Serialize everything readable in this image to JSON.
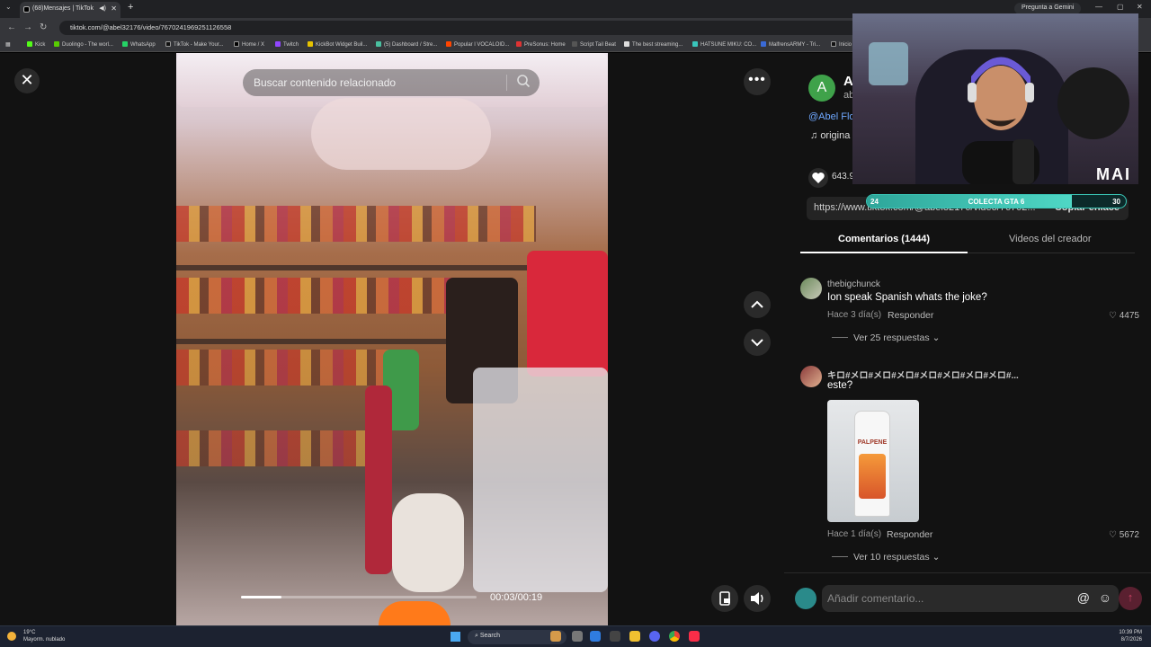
{
  "browser": {
    "tab_title": "(68)Mensajes | TikTok",
    "tab_close": "✕",
    "new_tab": "+",
    "gemini_label": "Pregunta a Gemini",
    "url": "tiktok.com/@abel32176/video/7670241969251126558",
    "bookmarks": [
      "Kick",
      "Duolingo - The worl...",
      "WhatsApp",
      "TikTok - Make Your...",
      "Home / X",
      "Twitch",
      "KickBot Widget Buil...",
      "(5) Dashboard / Stre...",
      "Popular l VOCALOID...",
      "PreSonus: Home",
      "Script Tail Beat",
      "The best streaming...",
      "HATSUNE MIKU: CO...",
      "MalfrensARMY - Tri...",
      "Inicio"
    ]
  },
  "video": {
    "search_placeholder": "Buscar contenido relacionado",
    "time": "00:03/00:19",
    "progress": 0.17
  },
  "creator": {
    "avatar_letter": "A",
    "name": "A",
    "username": "ab",
    "handle": "@Abel Flo",
    "music": "origina",
    "likes": "643.9",
    "link": "https://www.tiktok.com/@abel32176/video/76702...",
    "copy_label": "Copiar enlace"
  },
  "tabs": {
    "comments": "Comentarios (1444)",
    "creator_videos": "Videos del creador"
  },
  "comments": [
    {
      "user": "thebigchunck",
      "text": "Ion speak Spanish whats the joke?",
      "time": "Hace 3 día(s)",
      "reply": "Responder",
      "likes": "4475",
      "views": "Ver 25 respuestas"
    },
    {
      "user": "キロ#メロ#メロ#メロ#メロ#メロ#メロ#メロ#...",
      "text": "este?",
      "time": "Hace 1 día(s)",
      "reply": "Responder",
      "likes": "5672",
      "views": "Ver 10 respuestas",
      "image_text": "PALPENE"
    }
  ],
  "compose": {
    "placeholder": "Añadir comentario...",
    "mention": "@",
    "emoji": "☺",
    "send": "↑"
  },
  "overlay": {
    "cam_tag": "MAI",
    "goal_start": "24",
    "goal_label": "COLECTA GTA 6",
    "goal_end": "30",
    "goal_fraction": 0.79
  },
  "taskbar": {
    "temp": "19°C",
    "weather": "Mayorm. nublado",
    "search": "Search",
    "time": "10:39 PM",
    "date": "8/7/2026"
  },
  "colors": {
    "accent": "#fe2c55",
    "link": "#6fa8ff",
    "goal": "#3ac8b8"
  }
}
